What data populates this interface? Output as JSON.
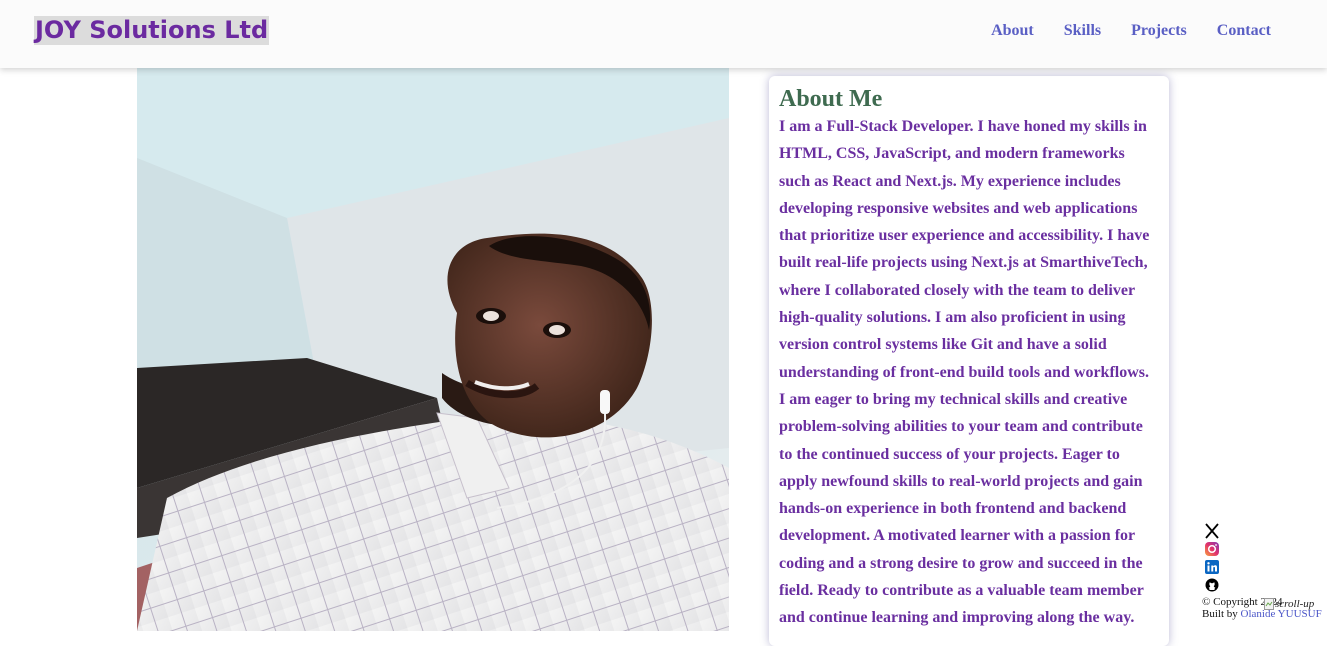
{
  "header": {
    "brand": "JOY Solutions Ltd",
    "nav": [
      "About",
      "Skills",
      "Projects",
      "Contact"
    ]
  },
  "about": {
    "title": "About Me",
    "text": "I am a Full-Stack Developer. I have honed my skills in HTML, CSS, JavaScript, and modern frameworks such as React and Next.js. My experience includes developing responsive websites and web applications that prioritize user experience and accessibility. I have built real-life projects using Next.js at SmarthiveTech, where I collaborated closely with the team to deliver high-quality solutions. I am also proficient in using version control systems like Git and have a solid understanding of front-end build tools and workflows. I am eager to bring my technical skills and creative problem-solving abilities to your team and contribute to the continued success of your projects. Eager to apply newfound skills to real-world projects and gain hands-on experience in both frontend and backend development. A motivated learner with a passion for coding and a strong desire to grow and succeed in the field. Ready to contribute as a valuable team member and continue learning and improving along the way."
  },
  "socials": {
    "icons": [
      "x-icon",
      "instagram-icon",
      "linkedin-icon",
      "github-icon"
    ],
    "colors": {
      "x": "#000000",
      "instagram": "#e1306c",
      "linkedin": "#0a66c2",
      "github": "#000000"
    }
  },
  "footer": {
    "copyright": "© Copyright 2024",
    "built_by_prefix": "Built by ",
    "author": "Olanide YUUSUF"
  },
  "scroll_up": {
    "alt": "scroll-up"
  },
  "colors": {
    "brand": "#6b2aa0",
    "nav_link": "#5a5fc4",
    "about_title": "#3f6b50",
    "about_text": "#6a2fa0"
  }
}
